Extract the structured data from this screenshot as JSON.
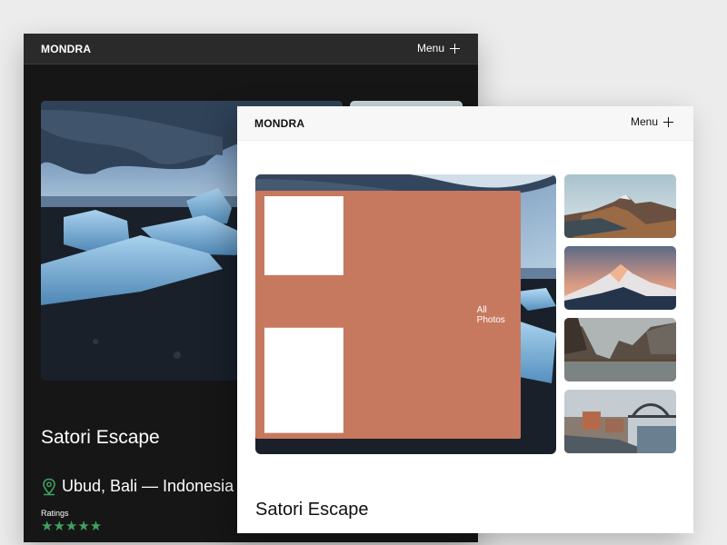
{
  "brand": {
    "logo": "MONDRA",
    "menu_label": "Menu"
  },
  "dark_view": {
    "title": "Satori Escape",
    "location": "Ubud, Bali — Indonesia",
    "ratings_label": "Ratings",
    "stars": "★★★★★",
    "rating_value": 5,
    "accent_color": "#3fa35f"
  },
  "light_view": {
    "title": "Satori Escape",
    "all_photos_label": "All Photos",
    "button_color": "#c6795e",
    "thumbnails": [
      {
        "subject": "mountain-coast"
      },
      {
        "subject": "snowy-peak-sunset"
      },
      {
        "subject": "lake-mountains"
      },
      {
        "subject": "harbour-bridge-city"
      }
    ]
  }
}
